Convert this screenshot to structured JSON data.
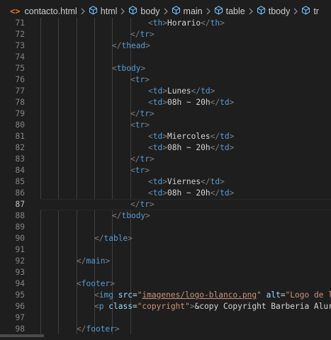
{
  "breadcrumb": {
    "file": "contacto.html",
    "path": [
      "html",
      "body",
      "main",
      "table",
      "tbody",
      "tr"
    ]
  },
  "editor": {
    "current_line": 87,
    "lines": [
      {
        "num": "71",
        "code": "<th>Horario</th>"
      },
      {
        "num": "72",
        "code": "</tr>"
      },
      {
        "num": "73",
        "code": "</thead>"
      },
      {
        "num": "74",
        "code": ""
      },
      {
        "num": "75",
        "code": "<tbody>"
      },
      {
        "num": "76",
        "code": "<tr>"
      },
      {
        "num": "77",
        "code": "<td>Lunes</td>"
      },
      {
        "num": "78",
        "code": "<td>08h ~ 20h</td>"
      },
      {
        "num": "79",
        "code": "</tr>"
      },
      {
        "num": "80",
        "code": "<tr>"
      },
      {
        "num": "81",
        "code": "<td>Miercoles</td>"
      },
      {
        "num": "82",
        "code": "<td>08h ~ 20h</td>"
      },
      {
        "num": "83",
        "code": "</tr>"
      },
      {
        "num": "84",
        "code": "<tr>"
      },
      {
        "num": "85",
        "code": "<td>Viernes</td>"
      },
      {
        "num": "86",
        "code": "<td>08h ~ 20h</td>"
      },
      {
        "num": "87",
        "code": "</tr>"
      },
      {
        "num": "88",
        "code": "</tbody>"
      },
      {
        "num": "89",
        "code": ""
      },
      {
        "num": "90",
        "code": "</table>"
      },
      {
        "num": "91",
        "code": ""
      },
      {
        "num": "92",
        "code": "</main>"
      },
      {
        "num": "93",
        "code": ""
      },
      {
        "num": "94",
        "code": "<footer>"
      },
      {
        "num": "95",
        "code": "<img src=\"imagenes/logo-blanco.png\" alt=\"Logo de la B"
      },
      {
        "num": "96",
        "code": "<p class=\"copyright\">&copy Copyright Barberia Alura -"
      },
      {
        "num": "97",
        "code": ""
      },
      {
        "num": "98",
        "code": "</footer>"
      }
    ]
  },
  "colors": {
    "background": "#1e1e1e",
    "tag": "#569cd6",
    "attribute": "#9cdcfe",
    "string": "#ce9178",
    "bracket": "#808080",
    "text": "#d4d4d4",
    "line_number": "#858585",
    "html_icon": "#e37933"
  }
}
